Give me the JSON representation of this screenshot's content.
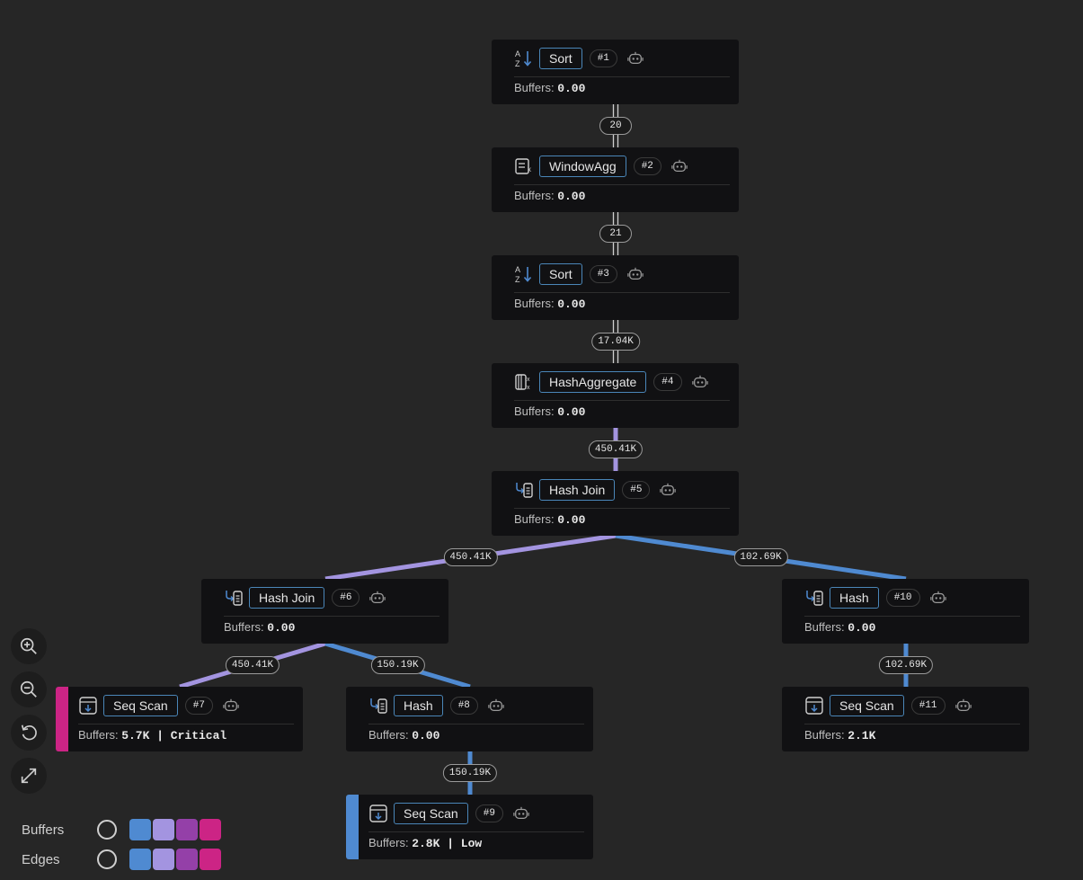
{
  "colors": {
    "neutral_edge": "#cfcfcf",
    "c1": "#4f8ad1",
    "c2": "#a394e0",
    "c3": "#9440a8",
    "c4": "#cc2485",
    "border": "#4a86b8"
  },
  "nodes": [
    {
      "id": "n1",
      "name": "Sort",
      "num": "#1",
      "icon": "sort-az-icon",
      "buffers_label": "Buffers:",
      "buffers": "0.00"
    },
    {
      "id": "n2",
      "name": "WindowAgg",
      "num": "#2",
      "icon": "window-agg-icon",
      "buffers_label": "Buffers:",
      "buffers": "0.00"
    },
    {
      "id": "n3",
      "name": "Sort",
      "num": "#3",
      "icon": "sort-az-icon",
      "buffers_label": "Buffers:",
      "buffers": "0.00"
    },
    {
      "id": "n4",
      "name": "HashAggregate",
      "num": "#4",
      "icon": "hash-aggregate-icon",
      "buffers_label": "Buffers:",
      "buffers": "0.00"
    },
    {
      "id": "n5",
      "name": "Hash Join",
      "num": "#5",
      "icon": "hash-join-icon",
      "buffers_label": "Buffers:",
      "buffers": "0.00"
    },
    {
      "id": "n6",
      "name": "Hash Join",
      "num": "#6",
      "icon": "hash-join-icon",
      "buffers_label": "Buffers:",
      "buffers": "0.00"
    },
    {
      "id": "n7",
      "name": "Seq Scan",
      "num": "#7",
      "icon": "seq-scan-icon",
      "buffers_label": "Buffers:",
      "buffers": "5.7K | Critical",
      "accent": "c4"
    },
    {
      "id": "n8",
      "name": "Hash",
      "num": "#8",
      "icon": "hash-join-icon",
      "buffers_label": "Buffers:",
      "buffers": "0.00"
    },
    {
      "id": "n9",
      "name": "Seq Scan",
      "num": "#9",
      "icon": "seq-scan-icon",
      "buffers_label": "Buffers:",
      "buffers": "2.8K | Low",
      "accent": "c1"
    },
    {
      "id": "n10",
      "name": "Hash",
      "num": "#10",
      "icon": "hash-join-icon",
      "buffers_label": "Buffers:",
      "buffers": "0.00"
    },
    {
      "id": "n11",
      "name": "Seq Scan",
      "num": "#11",
      "icon": "seq-scan-icon",
      "buffers_label": "Buffers:",
      "buffers": "2.1K"
    }
  ],
  "edges": [
    {
      "from": "n1",
      "to": "n2",
      "rows": "20",
      "style": "neutral"
    },
    {
      "from": "n2",
      "to": "n3",
      "rows": "21",
      "style": "neutral"
    },
    {
      "from": "n3",
      "to": "n4",
      "rows": "17.04K",
      "style": "neutral"
    },
    {
      "from": "n4",
      "to": "n5",
      "rows": "450.41K",
      "style": "c2"
    },
    {
      "from": "n5",
      "to": "n6",
      "rows": "450.41K",
      "style": "c2"
    },
    {
      "from": "n5",
      "to": "n10",
      "rows": "102.69K",
      "style": "c1"
    },
    {
      "from": "n6",
      "to": "n7",
      "rows": "450.41K",
      "style": "c2"
    },
    {
      "from": "n6",
      "to": "n8",
      "rows": "150.19K",
      "style": "c1"
    },
    {
      "from": "n8",
      "to": "n9",
      "rows": "150.19K",
      "style": "c1"
    },
    {
      "from": "n10",
      "to": "n11",
      "rows": "102.69K",
      "style": "c1"
    }
  ],
  "controls": [
    "zoom-in-icon",
    "zoom-out-icon",
    "reset-icon",
    "fit-view-icon"
  ],
  "legend": {
    "buffers_label": "Buffers",
    "edges_label": "Edges",
    "swatches": [
      "c1",
      "c2",
      "c3",
      "c4"
    ]
  }
}
